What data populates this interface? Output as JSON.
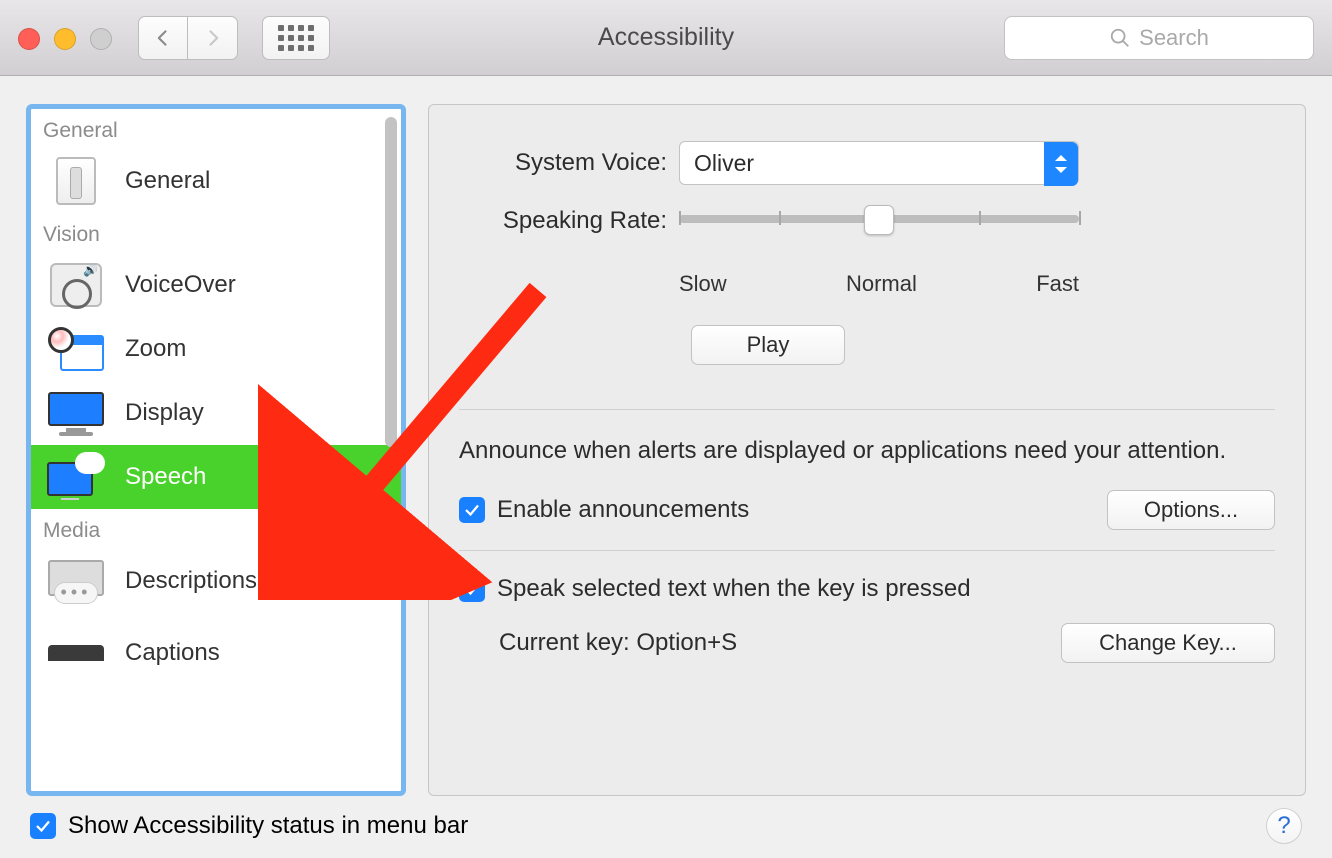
{
  "window": {
    "title": "Accessibility"
  },
  "toolbar": {
    "search_placeholder": "Search"
  },
  "sidebar": {
    "sections": [
      {
        "header": "General",
        "items": [
          {
            "label": "General"
          }
        ]
      },
      {
        "header": "Vision",
        "items": [
          {
            "label": "VoiceOver"
          },
          {
            "label": "Zoom"
          },
          {
            "label": "Display"
          },
          {
            "label": "Speech",
            "selected": true
          }
        ]
      },
      {
        "header": "Media",
        "items": [
          {
            "label": "Descriptions"
          },
          {
            "label": "Captions"
          }
        ]
      }
    ]
  },
  "main": {
    "system_voice_label": "System Voice:",
    "system_voice_value": "Oliver",
    "speaking_rate_label": "Speaking Rate:",
    "rate_slow": "Slow",
    "rate_normal": "Normal",
    "rate_fast": "Fast",
    "play_label": "Play",
    "announce_text": "Announce when alerts are displayed or applications need your attention.",
    "enable_announcements_label": "Enable announcements",
    "options_label": "Options...",
    "speak_selected_label": "Speak selected text when the key is pressed",
    "current_key_label": "Current key: ",
    "current_key_value": "Option+S",
    "change_key_label": "Change Key..."
  },
  "footer": {
    "show_status_label": "Show Accessibility status in menu bar",
    "help": "?"
  }
}
